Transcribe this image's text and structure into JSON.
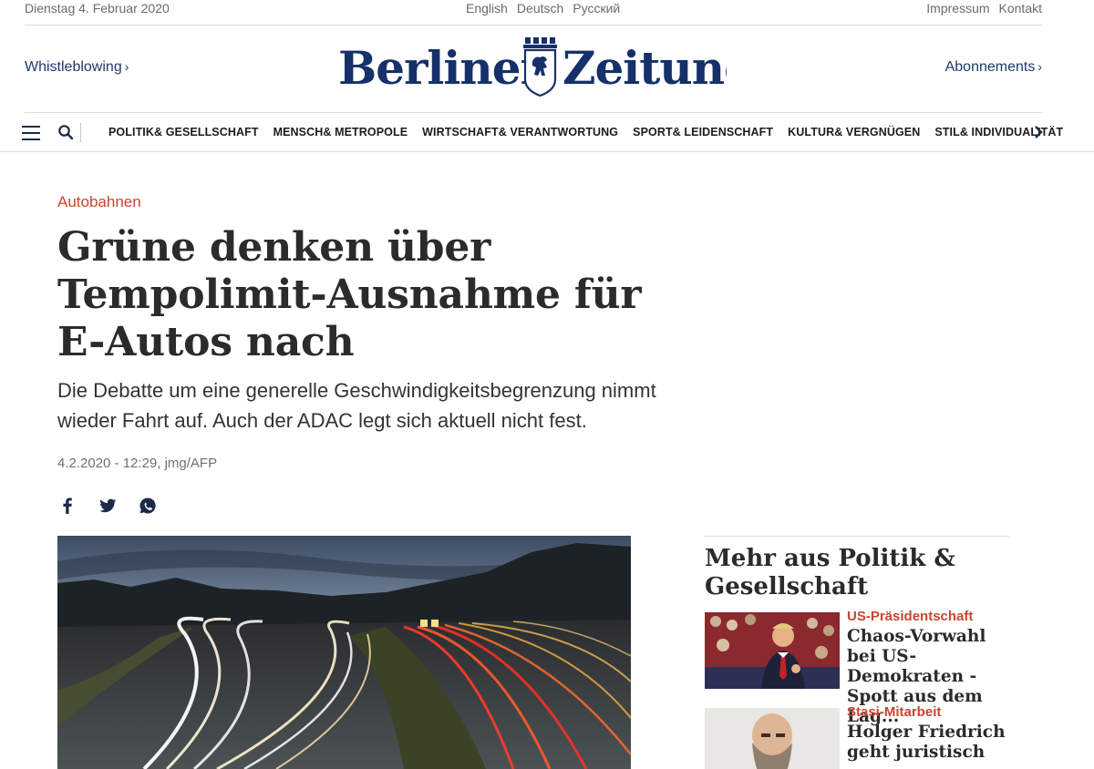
{
  "topbar": {
    "date": "Dienstag 4. Februar 2020",
    "languages": [
      "English",
      "Deutsch",
      "Русский"
    ],
    "links": [
      "Impressum",
      "Kontakt"
    ]
  },
  "masthead": {
    "left_link": "Whistleblowing",
    "right_link": "Abonnements",
    "logo_text": "Berliner Zeitung"
  },
  "nav": {
    "items": [
      "POLITIK& GESELLSCHAFT",
      "MENSCH& METROPOLE",
      "WIRTSCHAFT& VERANTWORTUNG",
      "SPORT& LEIDENSCHAFT",
      "KULTUR& VERGNÜGEN",
      "STIL& INDIVIDUALITÄT"
    ]
  },
  "article": {
    "kicker": "Autobahnen",
    "headline": "Grüne denken über Tempolimit-Ausnahme für E-Autos nach",
    "teaser": "Die Debatte um eine generelle Geschwindigkeitsbegrenzung nimmt wieder Fahrt auf. Auch der ADAC legt sich aktuell nicht fest.",
    "meta": "4.2.2020 - 12:29, jmg/AFP"
  },
  "sidebar": {
    "title": "Mehr aus Politik & Gesellschaft",
    "cards": [
      {
        "kicker": "US-Präsidentschaft",
        "title": "Chaos-Vorwahl bei US-Demokraten - Spott aus dem Lag..."
      },
      {
        "kicker": "Stasi-Mitarbeit",
        "title": "Holger Friedrich geht juristisch"
      }
    ]
  },
  "colors": {
    "accent": "#c8462e",
    "brand_blue": "#1f3a6b",
    "text_dark": "#2b2b2b",
    "muted": "#707070"
  }
}
